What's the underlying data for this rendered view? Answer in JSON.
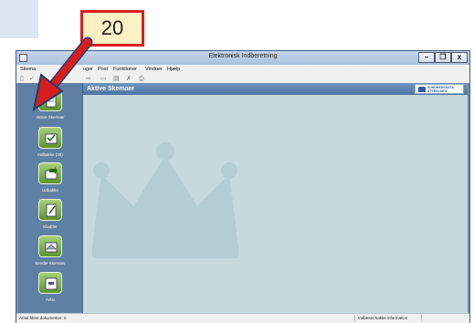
{
  "annotation": {
    "step_number": "20"
  },
  "window": {
    "title": "Elektronisk Indberetning",
    "buttons": {
      "minimize": "–",
      "maximize": "❐",
      "close": "x"
    }
  },
  "menu": {
    "items": [
      {
        "label": "Skema"
      },
      {
        "label": "uger"
      },
      {
        "label": "Post"
      },
      {
        "label": "Funktioner"
      },
      {
        "label": "Vinduer"
      },
      {
        "label": "Hjælp"
      }
    ]
  },
  "sidebar": {
    "items": [
      {
        "label": "Aktive Skemaer",
        "icon": "document-icon"
      },
      {
        "label": "Indbakke (39)",
        "icon": "inbox-icon"
      },
      {
        "label": "Udbakke",
        "icon": "outbox-icon"
      },
      {
        "label": "Kladder",
        "icon": "draft-icon"
      },
      {
        "label": "Sendte Skemaer",
        "icon": "sent-icon"
      },
      {
        "label": "Arkiv",
        "icon": "archive-icon"
      }
    ]
  },
  "main": {
    "header_title": "Aktive Skemaer",
    "logo_line1": "SUNDHEDSDATA",
    "logo_line2": "STYRELSEN"
  },
  "status": {
    "left": "Antal åbne dokumenter: 0",
    "right": "Indlæser bakke information"
  },
  "colors": {
    "annotation_border": "#d91e1e",
    "annotation_fill": "#fdf0c6",
    "sidebar_bg": "#5f7fa3",
    "main_bg": "#c5d9df",
    "icon_green": "#7fb24a"
  }
}
